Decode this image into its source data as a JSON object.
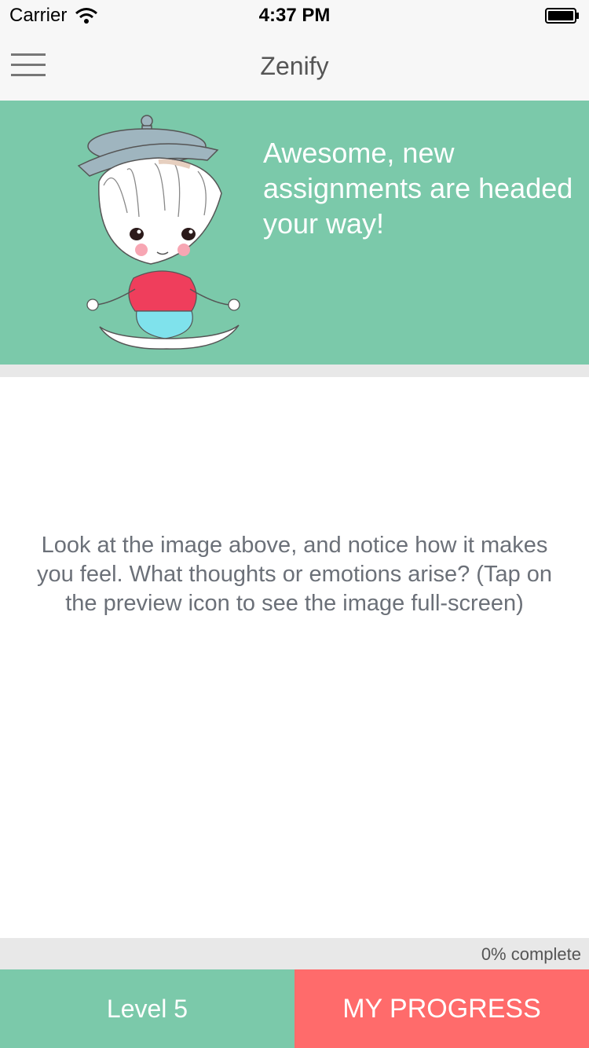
{
  "status_bar": {
    "carrier": "Carrier",
    "time": "4:37 PM",
    "wifi_icon": "wifi-icon",
    "battery_icon": "battery-icon"
  },
  "nav": {
    "title": "Zenify",
    "menu_icon": "hamburger-menu-icon"
  },
  "hero": {
    "message": "Awesome, new assignments are headed your way!",
    "illustration": "meditating-girl-illustration",
    "background_color": "#7bc9aa"
  },
  "prompt": {
    "text": "Look at the image above, and notice how it makes you feel. What thoughts or emotions arise? (Tap on the preview icon to see the image full-screen)"
  },
  "progress": {
    "percent": 0,
    "label": "0% complete"
  },
  "bottom_bar": {
    "level_label": "Level 5",
    "my_progress_label": "MY PROGRESS",
    "level_color": "#7bc9aa",
    "my_progress_color": "#ff6b6b"
  }
}
